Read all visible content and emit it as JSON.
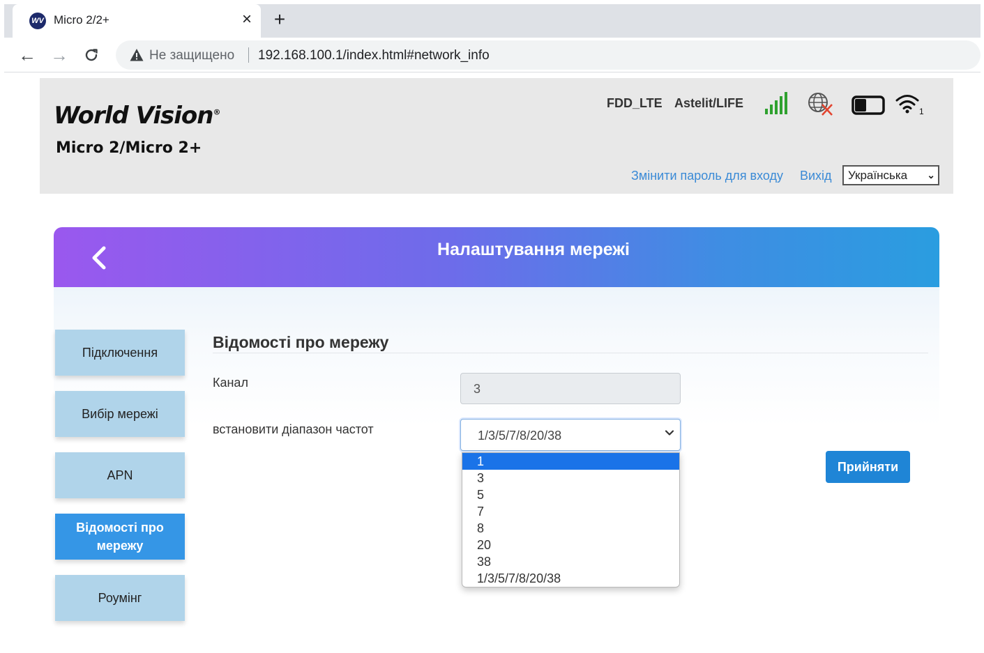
{
  "browser": {
    "tab_title": "Micro 2/2+",
    "tab_favicon_text": "WV",
    "tab_close": "×",
    "new_tab": "+",
    "back": "←",
    "forward": "→",
    "reload": "C",
    "security_label": "Не защищено",
    "url": "192.168.100.1/index.html#network_info"
  },
  "header": {
    "brand": "World Vision",
    "brand_reg": "®",
    "model": "Micro 2/Micro 2+",
    "network_type": "FDD_LTE",
    "operator": "Astelit/LIFE",
    "wifi_clients": "1",
    "change_password_link": "Змінити пароль для входу",
    "logout_link": "Вихід",
    "language": "Українська",
    "colors": {
      "signal": "#2fa12f",
      "disconnected": "#e2442f",
      "link": "#3a8ad6"
    }
  },
  "banner": {
    "title": "Налаштування мережі",
    "gradient": [
      "#9a58ee",
      "#2a9de0"
    ]
  },
  "sidebar": {
    "items": [
      {
        "label": "Підключення",
        "active": false
      },
      {
        "label": "Вибір мережі",
        "active": false
      },
      {
        "label": "APN",
        "active": false
      },
      {
        "label": "Відомості про мережу",
        "active": true
      },
      {
        "label": "Роумінг",
        "active": false
      }
    ]
  },
  "main": {
    "section_title": "Відомості про мережу",
    "channel_label": "Канал",
    "channel_value": "3",
    "band_label": "встановити діапазон частот",
    "band_selected": "1/3/5/7/8/20/38",
    "band_options": [
      "1",
      "3",
      "5",
      "7",
      "8",
      "20",
      "38",
      "1/3/5/7/8/20/38"
    ],
    "highlighted_option": "1",
    "accept_button": "Прийняти"
  }
}
